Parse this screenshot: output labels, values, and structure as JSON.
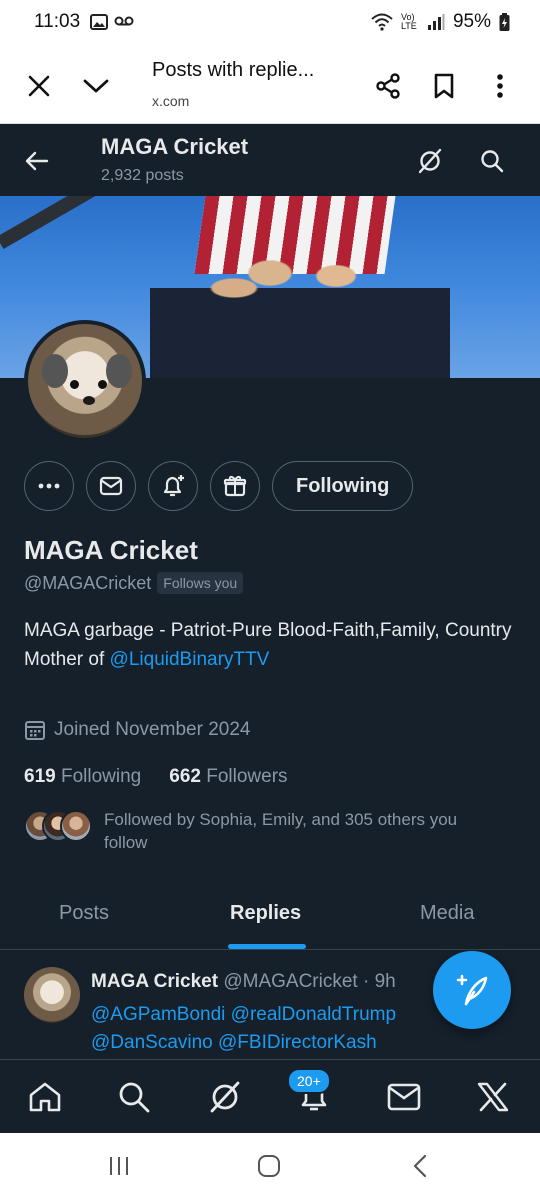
{
  "status_bar": {
    "time": "11:03",
    "battery": "95%",
    "network": "Vo) LTE"
  },
  "browser": {
    "title": "Posts with replie...",
    "url": "x.com",
    "icons": [
      "close-icon",
      "chevron-down-icon",
      "share-icon",
      "bookmark-icon",
      "more-vert-icon"
    ]
  },
  "header": {
    "name": "MAGA Cricket",
    "posts_count": "2,932 posts"
  },
  "profile": {
    "display_name": "MAGA Cricket",
    "handle": "@MAGACricket",
    "follows_you": "Follows you",
    "bio_line1": "MAGA garbage - Patriot-Pure Blood-Faith,Family, Country",
    "bio_line2_prefix": "Mother of ",
    "bio_link": "@LiquidBinaryTTV",
    "joined": "Joined November 2024",
    "following_count": "619",
    "following_label": "Following",
    "followers_count": "662",
    "followers_label": "Followers",
    "followed_by": "Followed by Sophia, Emily, and 305 others you follow"
  },
  "actions": {
    "following_button": "Following"
  },
  "tabs": [
    {
      "label": "Posts",
      "active": false
    },
    {
      "label": "Replies",
      "active": true
    },
    {
      "label": "Media",
      "active": false
    }
  ],
  "post": {
    "name": "MAGA Cricket",
    "handle": "@MAGACricket",
    "time": "· 9h",
    "body_line1": "@AGPamBondi @realDonaldTrump",
    "body_line2": "@DanScavino @FBIDirectorKash"
  },
  "bottom_nav": {
    "notifications_badge": "20+"
  },
  "colors": {
    "background": "#15202b",
    "accent": "#1d9bf0",
    "muted": "#8b98a5",
    "text": "#e7e9ea"
  }
}
